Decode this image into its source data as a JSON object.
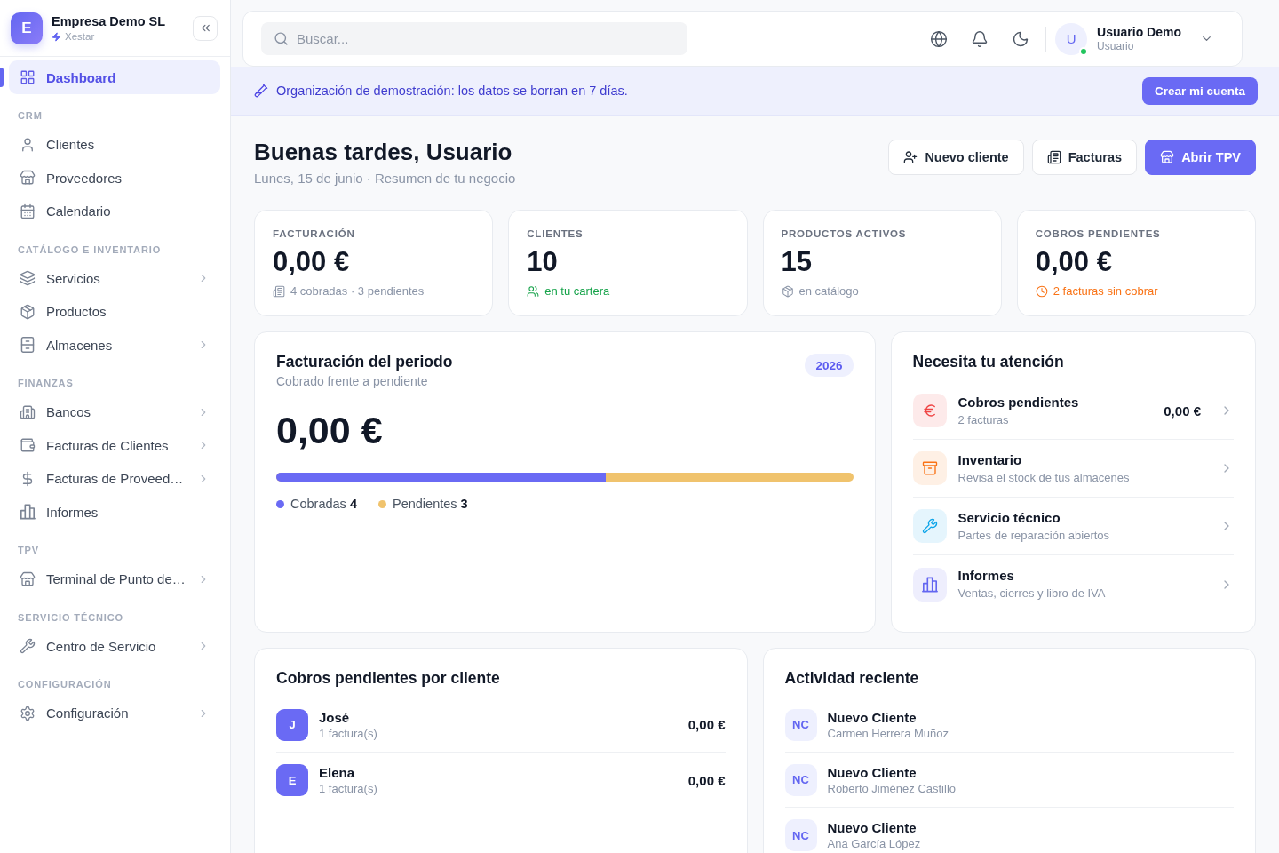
{
  "sidebar": {
    "brand": {
      "initial": "E",
      "name": "Empresa Demo SL",
      "product": "Xestar"
    },
    "top_items": [
      {
        "label": "Dashboard",
        "selected": true,
        "has_submenu": false
      }
    ],
    "sections": [
      {
        "title": "CRM",
        "items": [
          {
            "label": "Clientes",
            "selected": false,
            "has_submenu": false
          },
          {
            "label": "Proveedores",
            "selected": false,
            "has_submenu": false
          },
          {
            "label": "Calendario",
            "selected": false,
            "has_submenu": false
          }
        ]
      },
      {
        "title": "CATÁLOGO E INVENTARIO",
        "items": [
          {
            "label": "Servicios",
            "selected": false,
            "has_submenu": true
          },
          {
            "label": "Productos",
            "selected": false,
            "has_submenu": false
          },
          {
            "label": "Almacenes",
            "selected": false,
            "has_submenu": true
          }
        ]
      },
      {
        "title": "FINANZAS",
        "items": [
          {
            "label": "Bancos",
            "selected": false,
            "has_submenu": true
          },
          {
            "label": "Facturas de Clientes",
            "selected": false,
            "has_submenu": true
          },
          {
            "label": "Facturas de Proveed…",
            "selected": false,
            "has_submenu": true
          },
          {
            "label": "Informes",
            "selected": false,
            "has_submenu": false
          }
        ]
      },
      {
        "title": "TPV",
        "items": [
          {
            "label": "Terminal de Punto de…",
            "selected": false,
            "has_submenu": true
          }
        ]
      },
      {
        "title": "SERVICIO TÉCNICO",
        "items": [
          {
            "label": "Centro de Servicio",
            "selected": false,
            "has_submenu": true
          }
        ]
      },
      {
        "title": "CONFIGURACIÓN",
        "items": [
          {
            "label": "Configuración",
            "selected": false,
            "has_submenu": true
          }
        ]
      }
    ]
  },
  "topbar": {
    "search": {
      "placeholder": "Buscar..."
    },
    "user": {
      "initial": "U",
      "name": "Usuario Demo",
      "role": "Usuario",
      "online": true
    }
  },
  "banner": {
    "message": "Organización de demostración: los datos se borran en 7 días.",
    "button": "Crear mi cuenta"
  },
  "page_header": {
    "title": "Buenas tardes, Usuario",
    "subtitle": "Lunes, 15 de junio · Resumen de tu negocio",
    "actions": [
      {
        "label": "Nuevo cliente",
        "kind": "secondary"
      },
      {
        "label": "Facturas",
        "kind": "secondary"
      },
      {
        "label": "Abrir TPV",
        "kind": "primary"
      }
    ]
  },
  "stats": [
    {
      "label": "FACTURACIÓN",
      "value": "0,00 €",
      "note": "4 cobradas · 3 pendientes",
      "color": "#8b95a7"
    },
    {
      "label": "CLIENTES",
      "value": "10",
      "note": "en tu cartera",
      "color": "#16a34a"
    },
    {
      "label": "PRODUCTOS ACTIVOS",
      "value": "15",
      "note": "en catálogo",
      "color": "#8b95a7"
    },
    {
      "label": "COBROS PENDIENTES",
      "value": "0,00 €",
      "note": "2 facturas sin cobrar",
      "color": "#f97316"
    }
  ],
  "period": {
    "title": "Facturación del periodo",
    "subtitle": "Cobrado frente a pendiente",
    "badge": "2026",
    "amount": "0,00 €",
    "level": 0.571,
    "legend": [
      {
        "label": "Cobradas **4**",
        "color": "#6a6af4"
      },
      {
        "label": "Pendientes **3**",
        "color": "#f0c36d"
      }
    ]
  },
  "attention": {
    "title": "Necesita tu atención",
    "items": [
      {
        "title": "Cobros pendientes",
        "subtitle": "2 facturas",
        "value": "0,00 €",
        "color": "#ef4444"
      },
      {
        "title": "Inventario",
        "subtitle": "Revisa el stock de tus almacenes",
        "color": "#f97316"
      },
      {
        "title": "Servicio técnico",
        "subtitle": "Partes de reparación abiertos",
        "color": "#0ea5e9"
      },
      {
        "title": "Informes",
        "subtitle": "Ventas, cierres y libro de IVA",
        "color": "#6366f1"
      }
    ]
  },
  "pending_by_client": {
    "title": "Cobros pendientes por cliente",
    "rows": [
      {
        "initial": "J",
        "name": "José",
        "detail": "1 factura(s)",
        "amount": "0,00 €"
      },
      {
        "initial": "E",
        "name": "Elena",
        "detail": "1 factura(s)",
        "amount": "0,00 €"
      }
    ]
  },
  "recent_activity": {
    "title": "Actividad reciente",
    "rows": [
      {
        "badge": "NC",
        "title": "Nuevo Cliente",
        "detail": "Carmen Herrera Muñoz"
      },
      {
        "badge": "NC",
        "title": "Nuevo Cliente",
        "detail": "Roberto Jiménez Castillo"
      },
      {
        "badge": "NC",
        "title": "Nuevo Cliente",
        "detail": "Ana García López"
      }
    ]
  }
}
